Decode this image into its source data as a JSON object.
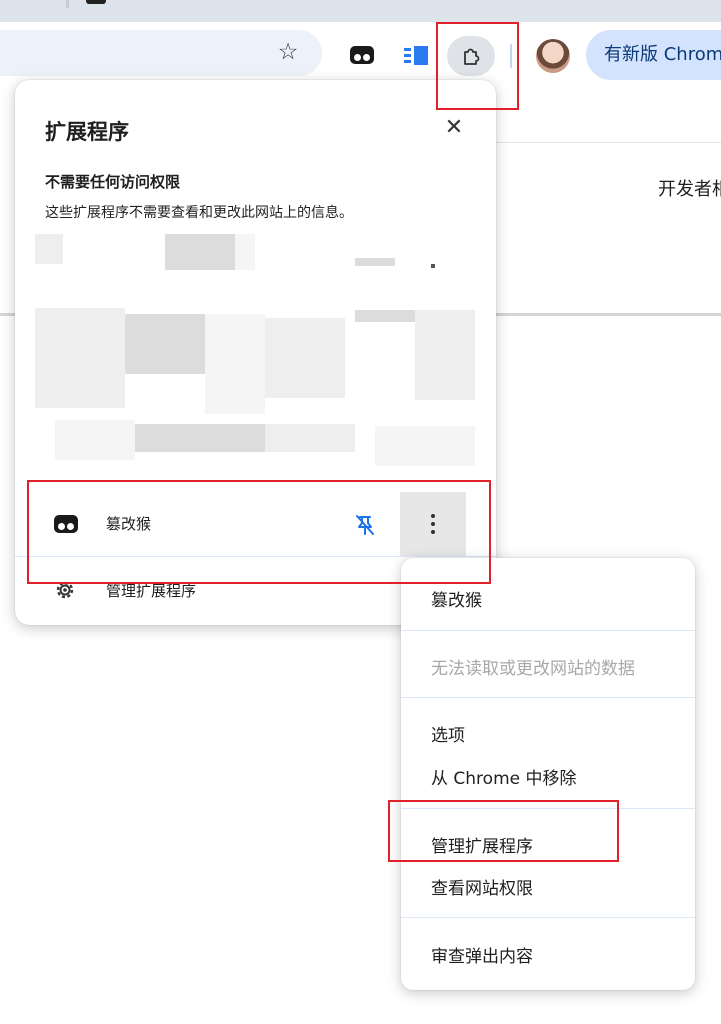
{
  "browser": {
    "update_button_label": "有新版 Chrome",
    "page_text_fragment": "开发者相"
  },
  "extensions_panel": {
    "title": "扩展程序",
    "section_title": "不需要任何访问权限",
    "section_desc": "这些扩展程序不需要查看和更改此网站上的信息。",
    "extension_name": "篡改猴",
    "manage_label": "管理扩展程序"
  },
  "context_menu": {
    "items": [
      {
        "label": "篡改猴",
        "enabled": true
      },
      {
        "label": "无法读取或更改网站的数据",
        "enabled": false
      },
      {
        "label": "选项",
        "enabled": true
      },
      {
        "label": "从 Chrome 中移除",
        "enabled": true
      },
      {
        "label": "管理扩展程序",
        "enabled": true
      },
      {
        "label": "查看网站权限",
        "enabled": true
      },
      {
        "label": "审查弹出内容",
        "enabled": true
      }
    ]
  },
  "icons": {
    "star": "bookmark-star-icon",
    "tampermonkey": "tampermonkey-icon",
    "reader": "reader-extension-icon",
    "extensions": "puzzle-icon",
    "close": "close-icon",
    "pin": "unpin-icon",
    "more": "more-vert-icon",
    "gear": "gear-icon"
  },
  "colors": {
    "highlight_box": "#e0202a",
    "pin_blue": "#1a73e8",
    "update_pill": "#d3e3fd"
  }
}
